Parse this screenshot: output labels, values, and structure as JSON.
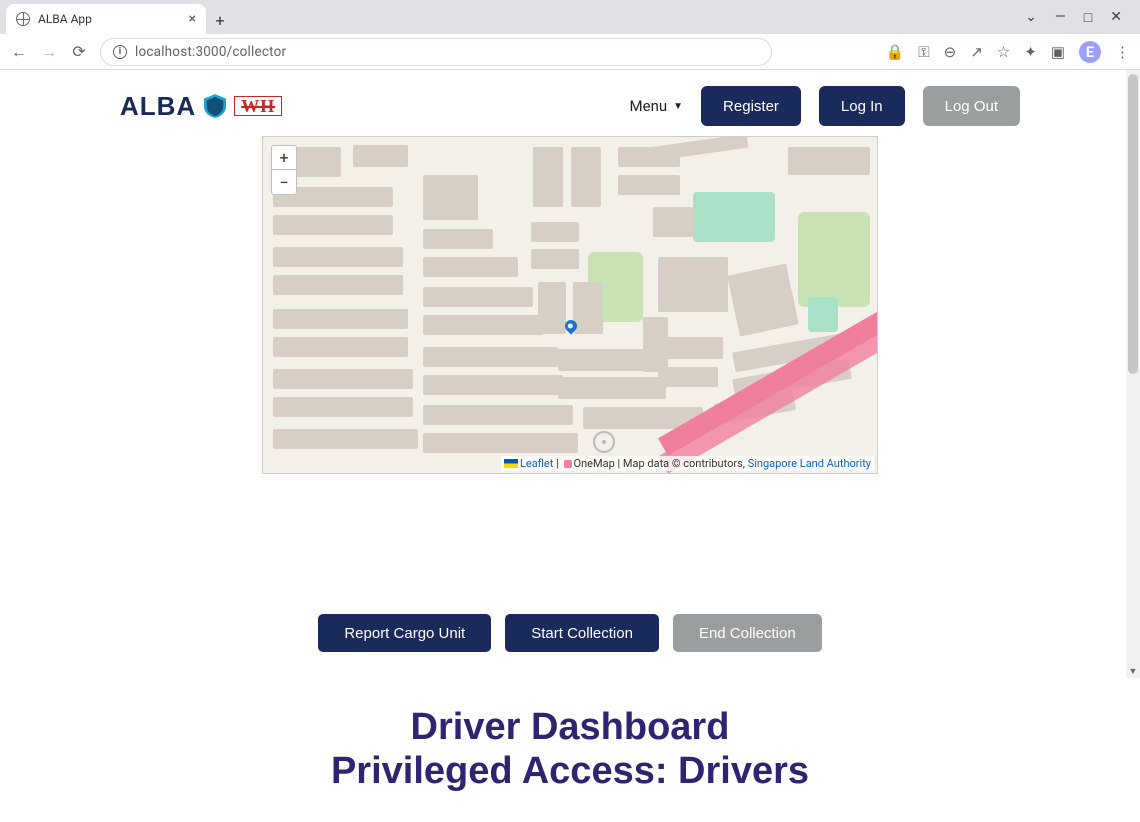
{
  "browser": {
    "tab_title": "ALBA App",
    "url": "localhost:3000/collector",
    "avatar_initial": "E"
  },
  "nav": {
    "brand_text": "ALBA",
    "brand_wh": "WH",
    "menu_label": "Menu",
    "register_label": "Register",
    "login_label": "Log In",
    "logout_label": "Log Out"
  },
  "map": {
    "zoom_in": "+",
    "zoom_out": "−",
    "attribution": {
      "leaflet": "Leaflet",
      "sep1": " | ",
      "onemap": "OneMap",
      "mid": " | Map data © contributors, ",
      "sla": "Singapore Land Authority"
    }
  },
  "actions": {
    "report": "Report Cargo Unit",
    "start": "Start Collection",
    "end": "End Collection"
  },
  "caption": {
    "line1": "Driver Dashboard",
    "line2": "Privileged Access: Drivers"
  }
}
